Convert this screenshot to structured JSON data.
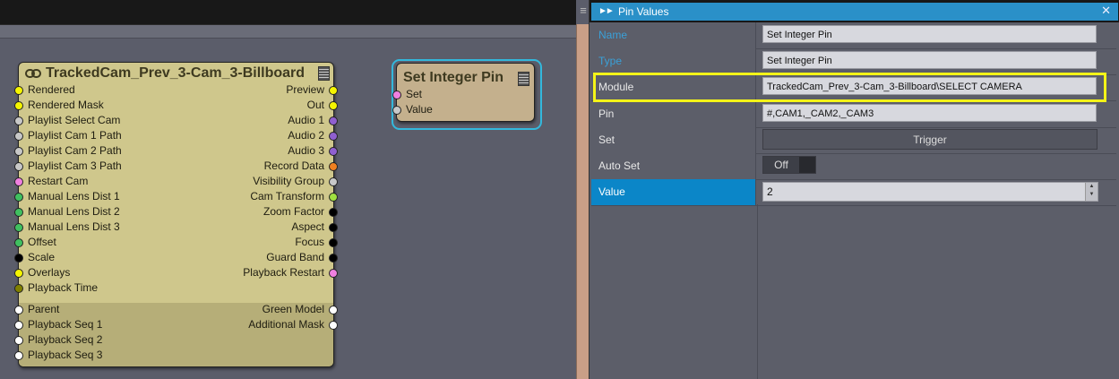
{
  "colors": {
    "node_body": "#cfc78c",
    "set_node_body": "#c4b08d",
    "selection_outline": "#33b8dc",
    "panel_header": "#2a90c8",
    "active_row": "#0b86c8",
    "highlight": "#f4f418"
  },
  "tracked_node": {
    "title": "TrackedCam_Prev_3-Cam_3-Billboard",
    "icon": "link-icon",
    "inputs": [
      {
        "label": "Rendered",
        "color": "#f5f500"
      },
      {
        "label": "Rendered Mask",
        "color": "#f5f500"
      },
      {
        "label": "Playlist Select Cam",
        "color": "#c8c8c8"
      },
      {
        "label": "Playlist Cam 1 Path",
        "color": "#c8c8c8"
      },
      {
        "label": "Playlist Cam 2 Path",
        "color": "#c8c8c8"
      },
      {
        "label": "Playlist Cam 3 Path",
        "color": "#c8c8c8"
      },
      {
        "label": "Restart Cam",
        "color": "#f080e0"
      },
      {
        "label": "Manual Lens Dist 1",
        "color": "#40c060"
      },
      {
        "label": "Manual Lens Dist 2",
        "color": "#40c060"
      },
      {
        "label": "Manual Lens Dist 3",
        "color": "#40c060"
      },
      {
        "label": "Offset",
        "color": "#40c060"
      },
      {
        "label": "Scale",
        "color": "#000000"
      },
      {
        "label": "Overlays",
        "color": "#f5f500"
      },
      {
        "label": "Playback Time",
        "color": "#808000"
      }
    ],
    "outputs": [
      {
        "label": "Preview",
        "color": "#f5f500"
      },
      {
        "label": "Out",
        "color": "#f5f500"
      },
      {
        "label": "Audio 1",
        "color": "#9060d0"
      },
      {
        "label": "Audio 2",
        "color": "#9060d0"
      },
      {
        "label": "Audio 3",
        "color": "#9060d0"
      },
      {
        "label": "Record Data",
        "color": "#f08020"
      },
      {
        "label": "Visibility Group",
        "color": "#c8c8c8"
      },
      {
        "label": "Cam Transform",
        "color": "#a0e040"
      },
      {
        "label": "Zoom Factor",
        "color": "#000000"
      },
      {
        "label": "Aspect",
        "color": "#000000"
      },
      {
        "label": "Focus",
        "color": "#000000"
      },
      {
        "label": "Guard Band",
        "color": "#000000"
      },
      {
        "label": "Playback Restart",
        "color": "#f080e0"
      }
    ],
    "lower_inputs": [
      {
        "label": "Parent",
        "color": "#ffffff"
      },
      {
        "label": "Playback Seq 1",
        "color": "#ffffff"
      },
      {
        "label": "Playback Seq 2",
        "color": "#ffffff"
      },
      {
        "label": "Playback Seq 3",
        "color": "#ffffff"
      }
    ],
    "lower_outputs": [
      {
        "label": "Green Model",
        "color": "#ffffff"
      },
      {
        "label": "Additional Mask",
        "color": "#ffffff"
      }
    ]
  },
  "set_node": {
    "title": "Set Integer Pin",
    "inputs": [
      {
        "label": "Set",
        "color": "#f080e0"
      },
      {
        "label": "Value",
        "color": "#c8c8c8"
      }
    ]
  },
  "panel": {
    "title": "Pin Values",
    "rows": {
      "name": {
        "label": "Name",
        "value": "Set Integer Pin"
      },
      "type": {
        "label": "Type",
        "value": "Set Integer Pin"
      },
      "module": {
        "label": "Module",
        "value": "TrackedCam_Prev_3-Cam_3-Billboard\\SELECT CAMERA"
      },
      "pin": {
        "label": "Pin",
        "value": "#,CAM1,_CAM2,_CAM3"
      },
      "set": {
        "label": "Set",
        "button": "Trigger"
      },
      "auto_set": {
        "label": "Auto Set",
        "toggle": "Off"
      },
      "value": {
        "label": "Value",
        "value": "2"
      }
    }
  }
}
